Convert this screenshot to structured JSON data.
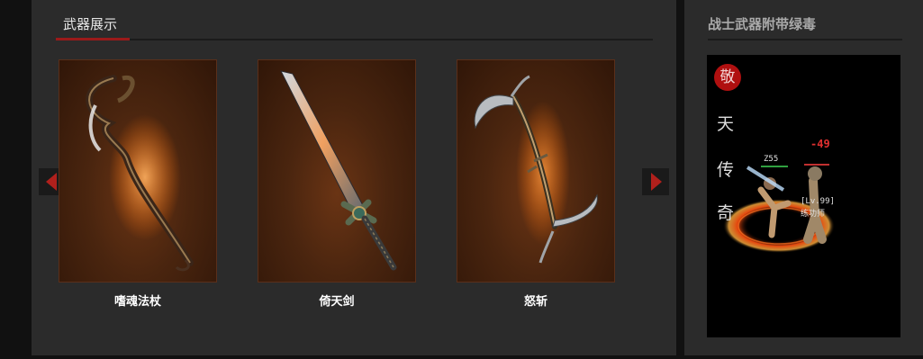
{
  "weapons_section": {
    "title": "武器展示",
    "prev_arrow_icon": "triangle-left-icon",
    "next_arrow_icon": "triangle-right-icon",
    "items": [
      {
        "name": "嗜魂法杖",
        "image_icon": "staff-icon"
      },
      {
        "name": "倚天剑",
        "image_icon": "sword-icon"
      },
      {
        "name": "怒斩",
        "image_icon": "scythe-icon"
      }
    ]
  },
  "video_section": {
    "title": "战士武器附带绿毒",
    "seal_char": "敬",
    "vertical_text": [
      "天",
      "传",
      "奇"
    ],
    "hud": {
      "enemy_number": "Z55",
      "damage_number": "-49",
      "npc_level": "[Lv.99]",
      "npc_name": "练功师"
    }
  },
  "colors": {
    "accent": "#9b1a1a",
    "panel_bg": "#2b2b2b",
    "page_bg": "#111111",
    "card_border": "#5a2f1a"
  }
}
